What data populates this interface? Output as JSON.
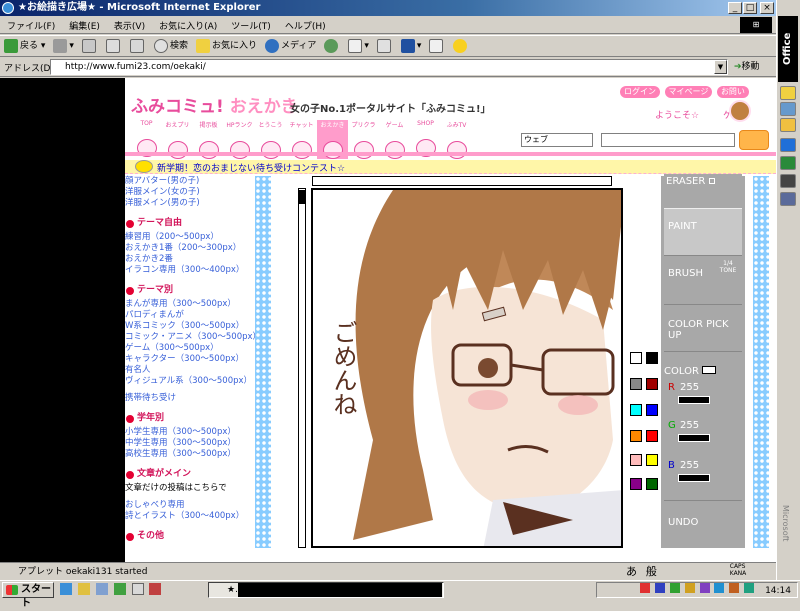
{
  "window": {
    "title": "★お絵描き広場★ - Microsoft Internet Explorer"
  },
  "menu": [
    "ファイル(F)",
    "編集(E)",
    "表示(V)",
    "お気に入り(A)",
    "ツール(T)",
    "ヘルプ(H)"
  ],
  "toolbar": {
    "back": "戻る",
    "search": "検索",
    "favorites": "お気に入り",
    "media": "メディア"
  },
  "address": {
    "label": "アドレス(D)",
    "url": "http://www.fumi23.com/oekaki/",
    "go": "移動"
  },
  "office": {
    "title": "Office",
    "vendor": "Microsoft"
  },
  "site": {
    "logo": "ふみコミュ!",
    "logo2": "おえかき",
    "subtitle": "女の子No.1ポータルサイト「ふみコミュ!」",
    "login_links": [
      "ログイン",
      "マイページ",
      "お問い"
    ],
    "welcome": "ようこそ☆",
    "user": "ゲス",
    "search_select": "ウェブ",
    "nav": [
      "TOP",
      "おえプリ",
      "掲示板",
      "HPランク",
      "とうこう",
      "チャット",
      "おえかき",
      "プリクラ",
      "ゲーム",
      "SHOP",
      "ふみTV"
    ],
    "news": "新学期！恋のおまじない待ち受けコンテスト☆"
  },
  "sidebar": {
    "top_links": [
      "顔アバター(男の子)",
      "洋服メイン(女の子)",
      "洋服メイン(男の子)"
    ],
    "sections": [
      {
        "title": "テーマ自由",
        "links": [
          "練習用（200〜500px）",
          "おえかき1番（200〜300px）",
          "おえかき2番",
          "イラコン専用（300〜400px）"
        ]
      },
      {
        "title": "テーマ別",
        "links": [
          "まんが専用（300〜500px）",
          "パロディまんが",
          "W系コミック（300〜500px）",
          "コミック・アニメ（300〜500px）",
          "ゲーム（300〜500px）",
          "キャラクター（300〜500px）",
          "有名人",
          "ヴィジュアル系（300〜500px）"
        ]
      },
      {
        "title": "",
        "links": [
          "携帯待ち受け"
        ]
      },
      {
        "title": "学年別",
        "links": [
          "小学生専用（300〜500px）",
          "中学生専用（300〜500px）",
          "高校生専用（300〜500px）"
        ]
      },
      {
        "title": "文章がメイン",
        "plain": "文章だけの投稿はこちらで",
        "links": [
          "おしゃべり専用",
          "詩とイラスト（300〜400px）"
        ]
      },
      {
        "title": "その他",
        "links": []
      }
    ]
  },
  "paint_panel": {
    "eraser": "ERASER",
    "paint": "PAINT",
    "brush": "BRUSH",
    "tone_label": "1/4 TONE",
    "color_pickup": "COLOR PICK UP",
    "color": "COLOR",
    "r_label": "R",
    "r_val": "255",
    "g_label": "G",
    "g_val": "255",
    "b_label": "B",
    "b_val": "255",
    "undo": "UNDO"
  },
  "canvas_text": "ごめんね",
  "status": {
    "text": "アプレット oekaki131 started"
  },
  "ime": {
    "a": "あ",
    "han": "般",
    "caps": "CAPS",
    "kana": "KANA"
  },
  "taskbar": {
    "start": "スタート",
    "task": "★..",
    "clock": "14:14"
  },
  "colors": {
    "brand_pink": "#e84c9c",
    "title_blue": "#0a246a",
    "panel_gray": "#a8a8a8"
  },
  "swatches": [
    "#ffffff",
    "#000000",
    "#888888",
    "#a00000",
    "#00ffff",
    "#0000ff",
    "#ff8800",
    "#ff0000",
    "#ffbbbb",
    "#ffff00",
    "#880088",
    "#006600"
  ]
}
